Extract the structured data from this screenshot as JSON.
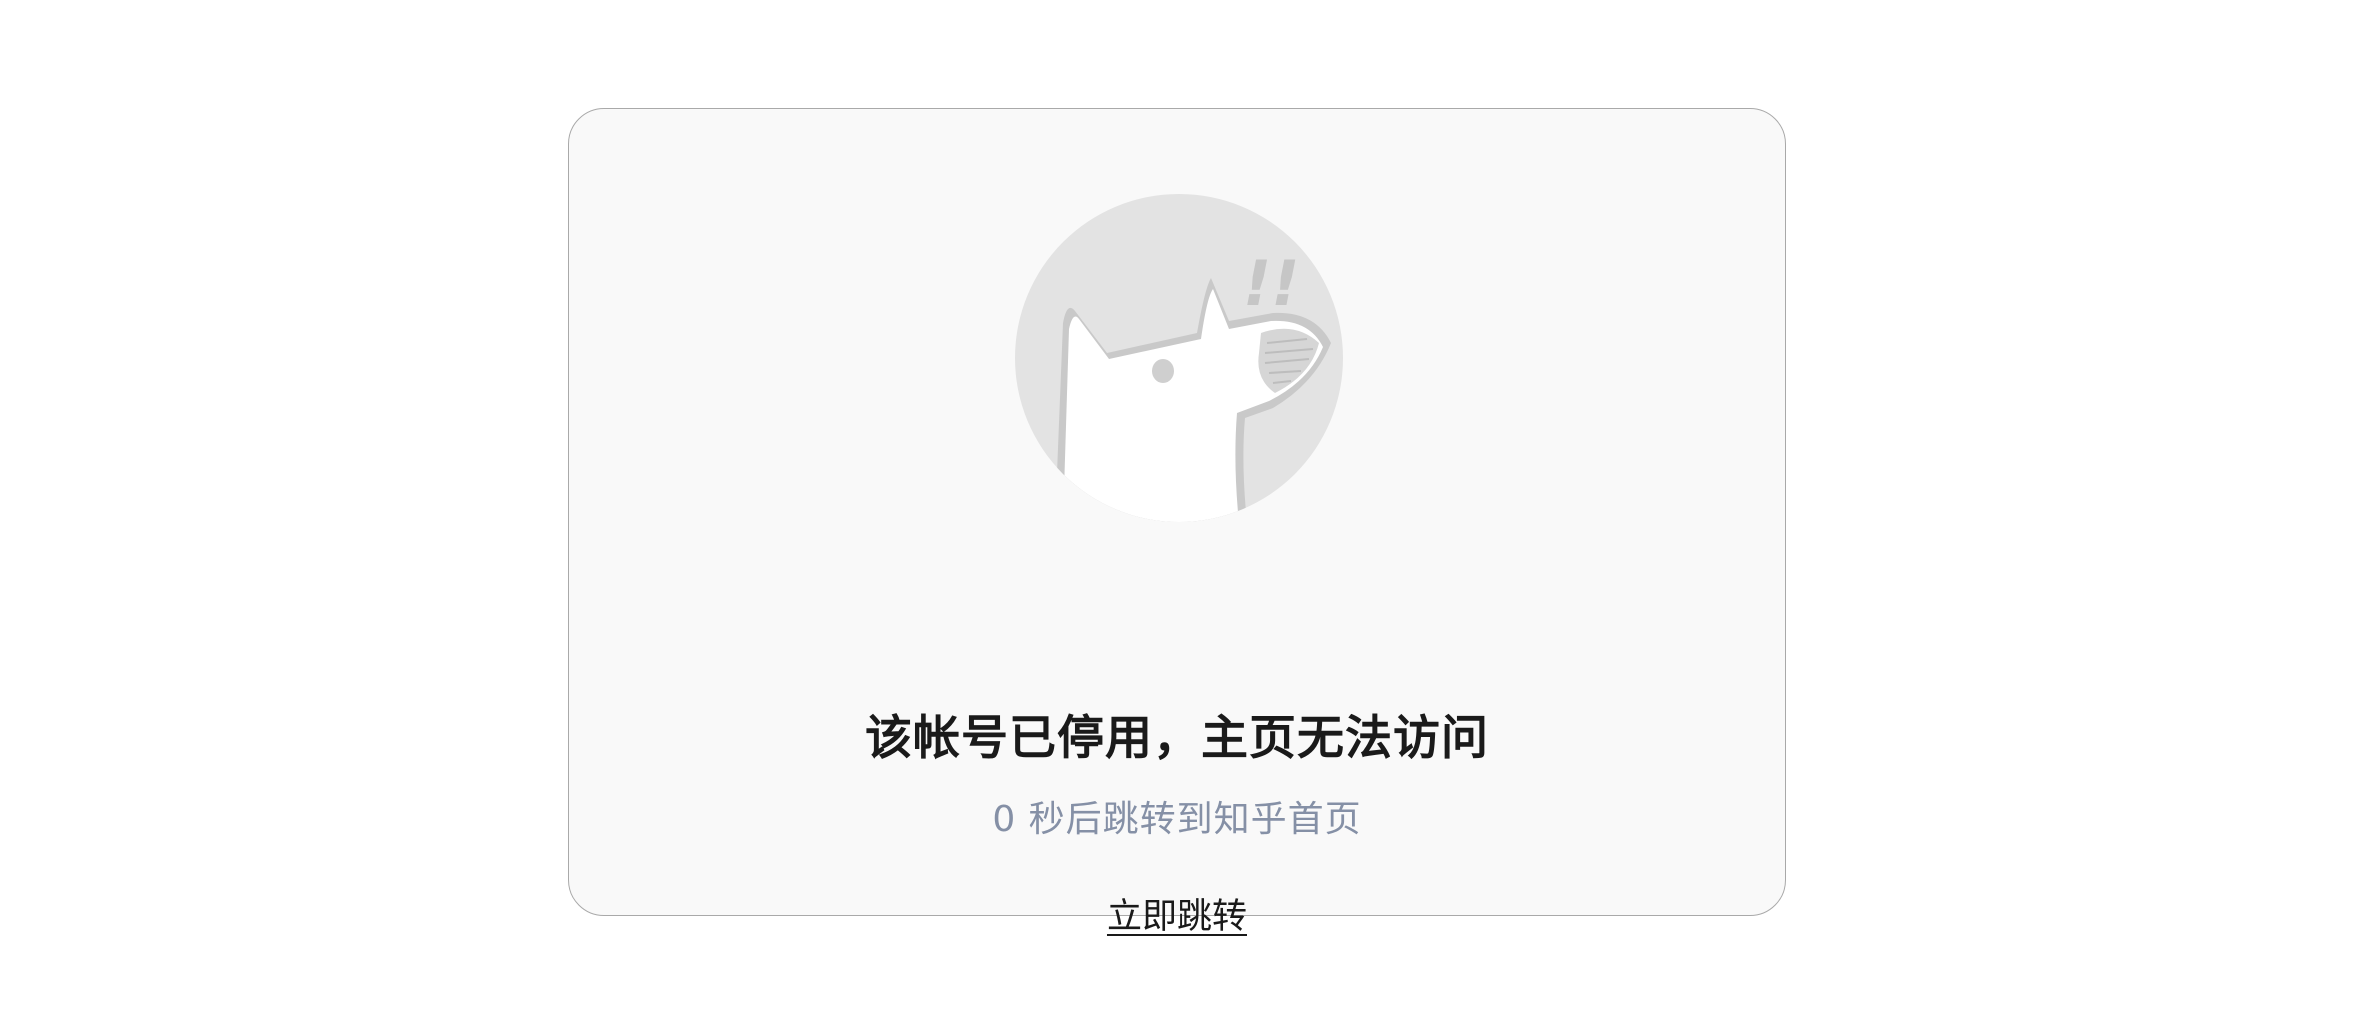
{
  "notice": {
    "title": "该帐号已停用，主页无法访问",
    "countdown": "0 秒后跳转到知乎首页",
    "redirect_link_label": "立即跳转",
    "illustration_exclamation": "!!"
  },
  "colors": {
    "card_background": "#f9f9f9",
    "card_border": "#a9a9a9",
    "title_text": "#1a1a1a",
    "countdown_text": "#8590a6",
    "illustration_circle": "#e3e3e3"
  }
}
